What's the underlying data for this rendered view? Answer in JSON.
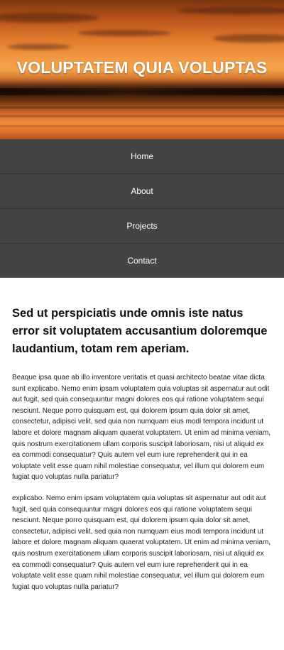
{
  "hero": {
    "title": "VOLUPTATEM QUIA VOLUPTAS"
  },
  "nav": {
    "items": [
      {
        "label": "Home"
      },
      {
        "label": "About"
      },
      {
        "label": "Projects"
      },
      {
        "label": "Contact"
      }
    ]
  },
  "main": {
    "headline": "Sed ut perspiciatis unde omnis iste natus error sit voluptatem accusantium doloremque laudantium, totam rem aperiam.",
    "paragraphs": [
      "Beaque ipsa quae ab illo inventore veritatis et quasi architecto beatae vitae dicta sunt explicabo. Nemo enim ipsam voluptatem quia voluptas sit aspernatur aut odit aut fugit, sed quia consequuntur magni dolores eos qui ratione voluptatem sequi nesciunt. Neque porro quisquam est, qui dolorem ipsum quia dolor sit amet, consectetur, adipisci velit, sed quia non numquam eius modi tempora incidunt ut labore et dolore magnam aliquam quaerat voluptatem. Ut enim ad minima veniam, quis nostrum exercitationem ullam corporis suscipit laboriosam, nisi ut aliquid ex ea commodi consequatur? Quis autem vel eum iure reprehenderit qui in ea voluptate velit esse quam nihil molestiae consequatur, vel illum qui dolorem eum fugiat quo voluptas nulla pariatur?",
      "explicabo. Nemo enim ipsam voluptatem quia voluptas sit aspernatur aut odit aut fugit, sed quia consequuntur magni dolores eos qui ratione voluptatem sequi nesciunt. Neque porro quisquam est, qui dolorem ipsum quia dolor sit amet, consectetur, adipisci velit, sed quia non numquam eius modi tempora incidunt ut labore et dolore magnam aliquam quaerat voluptatem. Ut enim ad minima veniam, quis nostrum exercitationem ullam corporis suscipit laboriosam, nisi ut aliquid ex ea commodi consequatur? Quis autem vel eum iure reprehenderit qui in ea voluptate velit esse quam nihil molestiae consequatur, vel illum qui dolorem eum fugiat quo voluptas nulla pariatur?"
    ]
  },
  "colors": {
    "nav_background": "#444444",
    "nav_divider": "#333333",
    "nav_text": "#ffffff",
    "body_text": "#222222",
    "page_background": "#ffffff"
  }
}
